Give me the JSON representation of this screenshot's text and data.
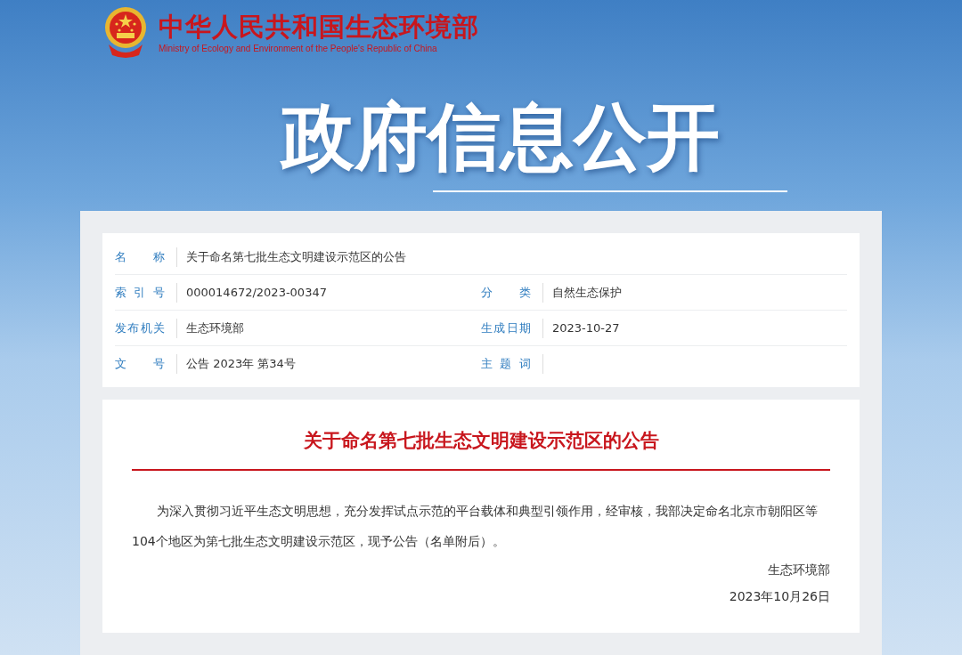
{
  "header": {
    "site_name": "中华人民共和国生态环境部",
    "site_name_en": "Ministry of Ecology and Environment of the People's Republic of China",
    "banner_title": "政府信息公开"
  },
  "info_table": {
    "rows": [
      [
        {
          "label": "名 称",
          "value": "关于命名第七批生态文明建设示范区的公告"
        }
      ],
      [
        {
          "label": "索 引 号",
          "value": "000014672/2023-00347"
        },
        {
          "label": "分 类",
          "value": "自然生态保护"
        }
      ],
      [
        {
          "label": "发布机关",
          "value": "生态环境部"
        },
        {
          "label": "生成日期",
          "value": "2023-10-27"
        }
      ],
      [
        {
          "label": "文 号",
          "value": "公告 2023年 第34号"
        },
        {
          "label": "主 题 词"
        }
      ]
    ]
  },
  "article": {
    "title": "关于命名第七批生态文明建设示范区的公告",
    "paragraph": "为深入贯彻习近平生态文明思想，充分发挥试点示范的平台载体和典型引领作用，经审核，我部决定命名北京市朝阳区等104个地区为第七批生态文明建设示范区，现予公告（名单附后）。",
    "signature": "生态环境部",
    "date": "2023年10月26日"
  }
}
